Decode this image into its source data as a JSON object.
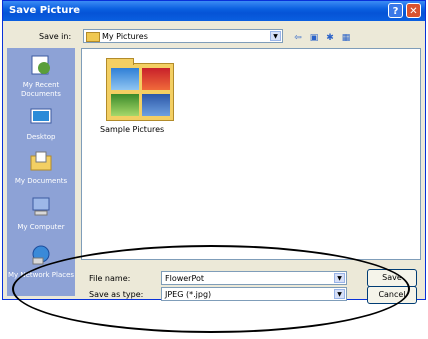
{
  "dialog": {
    "title": "Save Picture",
    "help_glyph": "?",
    "close_glyph": "✕"
  },
  "save_in": {
    "label": "Save in:",
    "value": "My Pictures"
  },
  "places": [
    {
      "label": "My Recent Documents"
    },
    {
      "label": "Desktop"
    },
    {
      "label": "My Documents"
    },
    {
      "label": "My Computer"
    },
    {
      "label": "My Network Places"
    }
  ],
  "files": [
    {
      "name": "Sample Pictures"
    }
  ],
  "file_name": {
    "label": "File name:",
    "value": "FlowerPot"
  },
  "save_as_type": {
    "label": "Save as type:",
    "value": "JPEG (*.jpg)"
  },
  "buttons": {
    "save": "Save",
    "cancel": "Cancel"
  },
  "colors": {
    "title_bar": "#0a5fe0",
    "places_bar": "#8da2d6",
    "dialog_bg": "#ece9d8"
  }
}
